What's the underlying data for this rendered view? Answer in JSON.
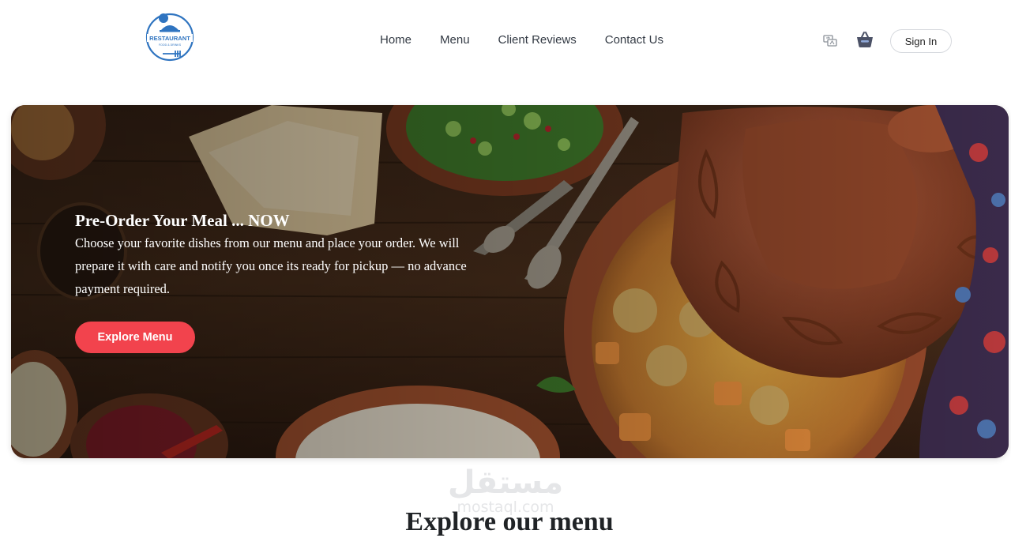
{
  "header": {
    "logo_text": "RESTAURANT",
    "logo_subtext": "FOOD & DRINKS",
    "nav": [
      {
        "label": "Home"
      },
      {
        "label": "Menu"
      },
      {
        "label": "Client Reviews"
      },
      {
        "label": "Contact Us"
      }
    ],
    "language_icon": "language-translate-icon",
    "cart_icon": "shopping-basket-icon",
    "signin_label": "Sign In"
  },
  "hero": {
    "title": "Pre-Order Your Meal ... NOW",
    "text": "Choose your favorite dishes from our menu and place your order. We will prepare it with care and notify you once its ready for pickup — no advance payment required.",
    "button_label": "Explore Menu"
  },
  "watermark": {
    "arabic": "مستقل",
    "latin": "mostaql.com"
  },
  "section": {
    "title": "Explore our menu"
  },
  "colors": {
    "brand_blue": "#2f74c0",
    "cta_red": "#f2434d",
    "nav_text": "#333a44"
  }
}
